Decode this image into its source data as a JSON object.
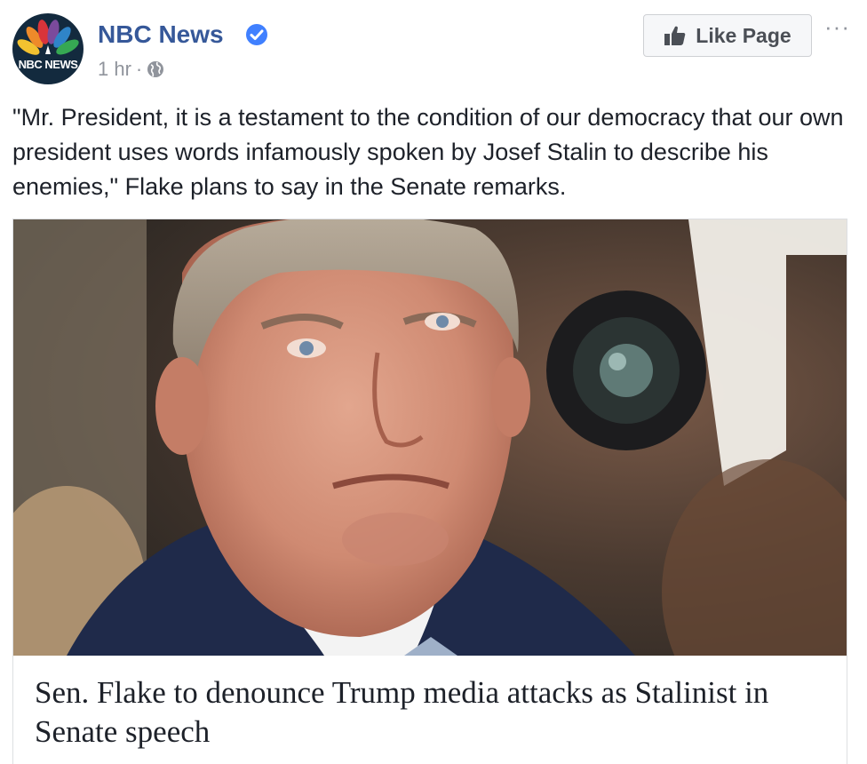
{
  "post": {
    "page_name": "NBC News",
    "avatar_label": "NBC NEWS",
    "timestamp": "1 hr",
    "separator": "·",
    "privacy_icon": "globe-icon",
    "verified_icon": "verified-badge-icon",
    "like_button_label": "Like Page",
    "like_icon": "thumbs-up-icon",
    "more_label": "···",
    "text": "\"Mr. President, it is a testament to the condition of our democracy that our own president uses words infamously spoken by Josef Stalin to describe his enemies,\" Flake plans to say in the Senate remarks."
  },
  "link_preview": {
    "image_description_icon": "photo-senator",
    "title": "Sen. Flake to denounce Trump media attacks as Stalinist in Senate speech"
  },
  "colors": {
    "page_name": "#365899",
    "meta": "#90949c",
    "verified": "#4080ff",
    "button_bg": "#f6f7f9",
    "text": "#1d2129"
  }
}
